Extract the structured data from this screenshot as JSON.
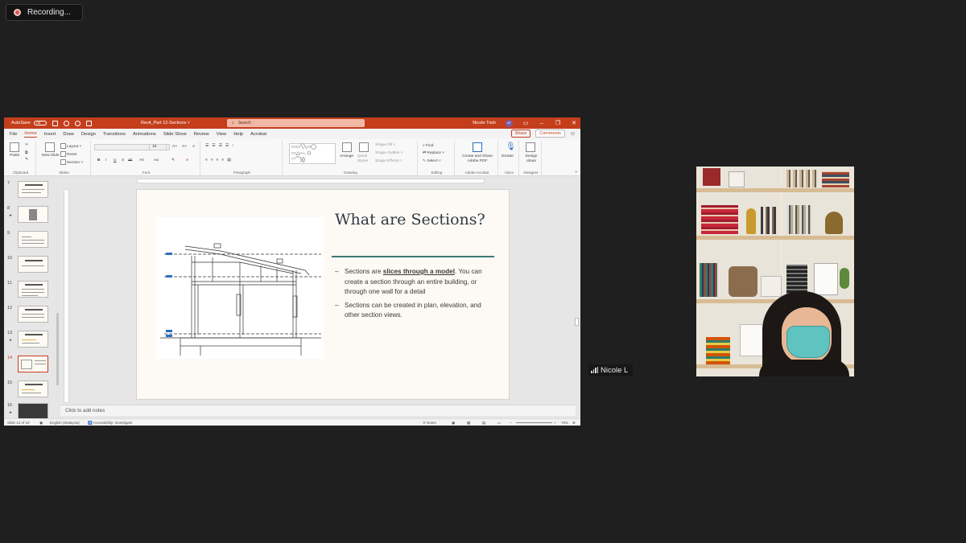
{
  "recording": {
    "label": "Recording..."
  },
  "ppt": {
    "autosave_label": "AutoSave",
    "autosave_state": "Off",
    "doc_title": "Revit_Part 12-Sections ˅",
    "search_placeholder": "Search",
    "user_name": "Nicole Trish",
    "user_initials": "NT",
    "tabs": [
      "File",
      "Home",
      "Insert",
      "Draw",
      "Design",
      "Transitions",
      "Animations",
      "Slide Show",
      "Review",
      "View",
      "Help",
      "Acrobat"
    ],
    "active_tab": "Home",
    "share_label": "Share",
    "comments_label": "Comments",
    "ribbon": {
      "paste": "Paste",
      "new_slide": "New Slide",
      "layout": "Layout ˅",
      "reset": "Reset",
      "section": "Section ˅",
      "arrange": "Arrange",
      "quick_styles": "Quick Styles",
      "shape_fill": "Shape Fill ˅",
      "shape_outline": "Shape Outline ˅",
      "shape_effects": "Shape Effects ˅",
      "find": "Find",
      "replace": "Replace ˅",
      "select": "Select ˅",
      "create_pdf": "Create and Share Adobe PDF",
      "dictate": "Dictate",
      "design_ideas": "Design Ideas",
      "font_size": "18",
      "groups": [
        "Clipboard",
        "Slides",
        "Font",
        "Paragraph",
        "Drawing",
        "Editing",
        "Adobe Acrobat",
        "Voice",
        "Designer"
      ]
    },
    "thumbnails": [
      {
        "num": "7",
        "star": ""
      },
      {
        "num": "8",
        "star": "★"
      },
      {
        "num": "9",
        "star": ""
      },
      {
        "num": "10",
        "star": ""
      },
      {
        "num": "11",
        "star": ""
      },
      {
        "num": "12",
        "star": ""
      },
      {
        "num": "13",
        "star": "★"
      },
      {
        "num": "14",
        "star": ""
      },
      {
        "num": "15",
        "star": ""
      },
      {
        "num": "16",
        "star": "★"
      }
    ],
    "active_slide": "14",
    "slide": {
      "title": "What are Sections?",
      "bullet1_pre": "Sections are ",
      "bullet1_bold": "slices through a model",
      "bullet1_post": ". You can create a section through an entire building, or through one wall for a detail",
      "bullet2": "Sections can be created in plan, elevation, and other section views.",
      "dash": "–"
    },
    "notes_placeholder": "Click to add notes",
    "status": {
      "slide_count": "Slide 14 of 19",
      "language": "English (Malaysia)",
      "accessibility": "Accessibility: Investigate",
      "notes": "Notes",
      "zoom": "78%"
    }
  },
  "participant": {
    "name": "Nicole L"
  },
  "colors": {
    "accent": "#c43e1c",
    "teal": "#3d7a75",
    "background": "#1f1f1f"
  }
}
